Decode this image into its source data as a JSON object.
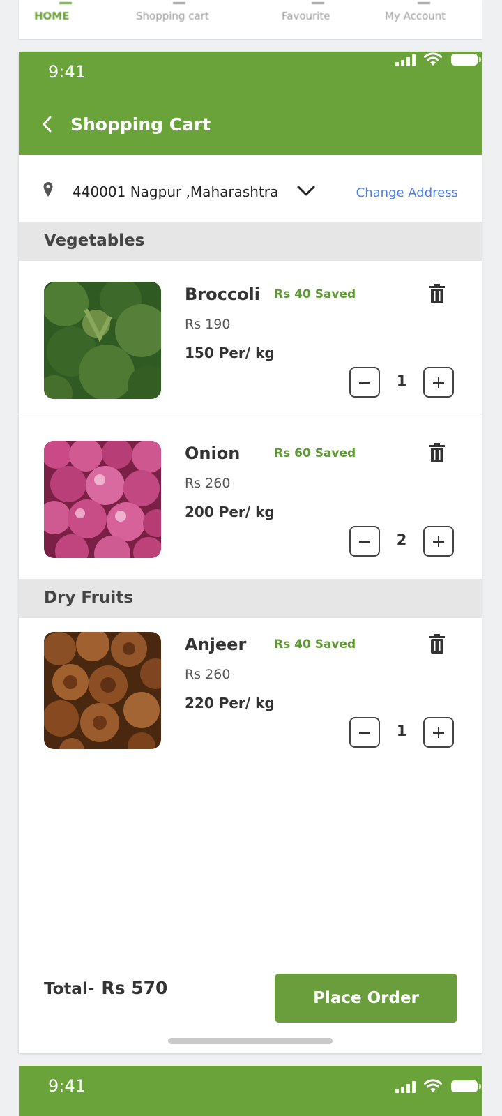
{
  "top_nav": {
    "items": [
      "HOME",
      "Shopping cart",
      "Favourite",
      "My Account"
    ],
    "active": "HOME"
  },
  "status_bar": {
    "time": "9:41"
  },
  "header": {
    "title": "Shopping Cart"
  },
  "address": {
    "text": "440001  Nagpur ,Maharashtra",
    "change_label": "Change Address"
  },
  "sections": [
    {
      "title": "Vegetables",
      "items": [
        {
          "name": "Broccoli",
          "saved": "Rs 40 Saved",
          "old_price": "Rs 190",
          "price": "150 Per/ kg",
          "qty": "1"
        },
        {
          "name": "Onion",
          "saved": "Rs 60 Saved",
          "old_price": "Rs 260",
          "price": "200 Per/ kg",
          "qty": "2"
        }
      ]
    },
    {
      "title": "Dry Fruits",
      "items": [
        {
          "name": "Anjeer",
          "saved": "Rs 40 Saved",
          "old_price": "Rs 260",
          "price": "220 Per/ kg",
          "qty": "1"
        }
      ]
    }
  ],
  "footer": {
    "total_label": "Total-",
    "total_amount": "Rs 570",
    "place_order_label": "Place Order"
  },
  "colors": {
    "brand_green": "#6aa33a",
    "saved_green": "#5e9a33",
    "link_blue": "#4a7ee8"
  }
}
